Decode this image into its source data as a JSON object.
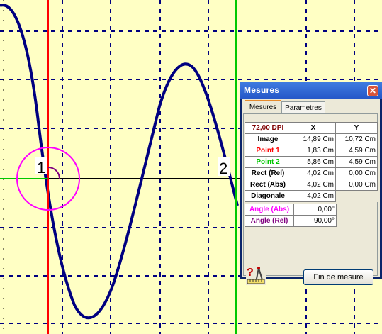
{
  "plot": {
    "background": "#FFFFC4",
    "curve_color": "#000080",
    "grid_color": "#000080",
    "marker1_color": "#FF0000",
    "marker2_color": "#00C800",
    "circle_color": "#FF00FF",
    "marker1_label": "1",
    "marker2_label": "2"
  },
  "dialog": {
    "title": "Mesures",
    "close_icon": "close-icon",
    "tabs": [
      {
        "label": "Mesures"
      },
      {
        "label": "Parametres"
      }
    ],
    "dpi": "72,00 DPI",
    "col_x": "X",
    "col_y": "Y",
    "rows": [
      {
        "label": "Image",
        "x": "14,89 Cm",
        "y": "10,72 Cm",
        "color": "#000000"
      },
      {
        "label": "Point 1",
        "x": "1,83 Cm",
        "y": "4,59 Cm",
        "color": "#FF0000"
      },
      {
        "label": "Point 2",
        "x": "5,86 Cm",
        "y": "4,59 Cm",
        "color": "#00C800"
      },
      {
        "label": "Rect (Rel)",
        "x": "4,02 Cm",
        "y": "0,00 Cm",
        "color": "#000000"
      },
      {
        "label": "Rect (Abs)",
        "x": "4,02 Cm",
        "y": "0,00 Cm",
        "color": "#000000"
      }
    ],
    "diagonal_label": "Diagonale",
    "diagonal_value": "4,02 Cm",
    "angles": [
      {
        "label": "Angle (Abs)",
        "value": "0,00°",
        "color": "#FF00FF"
      },
      {
        "label": "Angle (Rel)",
        "value": "90,00°",
        "color": "#800080"
      }
    ],
    "help_icon": "help-ruler-icon",
    "finish_button": "Fin de mesure"
  }
}
